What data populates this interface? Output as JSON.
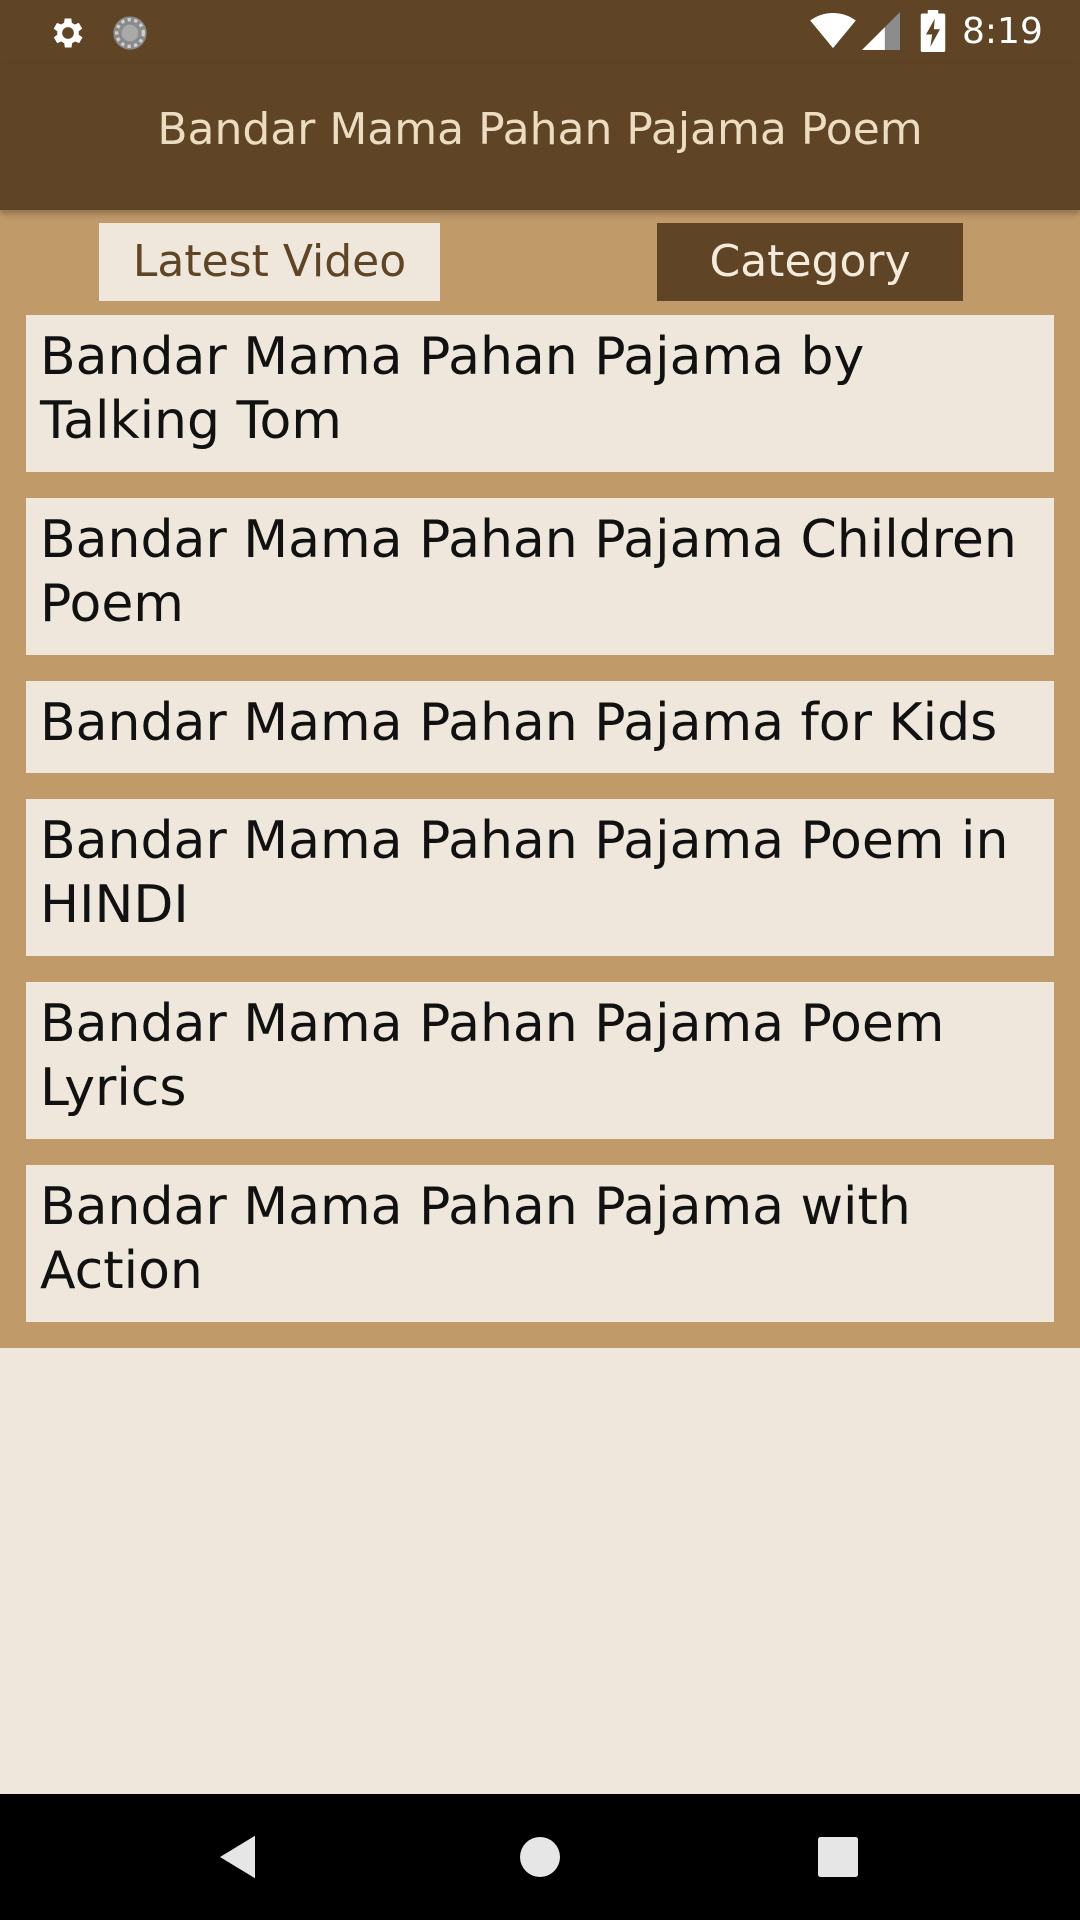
{
  "status_bar": {
    "time": "8:19",
    "left_icons": [
      "gear-icon",
      "sync-icon"
    ],
    "right_icons": [
      "wifi-icon",
      "signal-icon",
      "battery-charging-icon"
    ]
  },
  "app_bar": {
    "title": "Bandar Mama Pahan Pajama Poem"
  },
  "tabs": [
    {
      "label": "Latest Video",
      "selected": false
    },
    {
      "label": "Category",
      "selected": true
    }
  ],
  "videos": [
    {
      "title": "Bandar Mama Pahan Pajama by Talking Tom"
    },
    {
      "title": "Bandar Mama Pahan Pajama Children Poem"
    },
    {
      "title": "Bandar Mama Pahan Pajama for Kids"
    },
    {
      "title": "Bandar Mama Pahan Pajama Poem in HINDI"
    },
    {
      "title": "Bandar Mama Pahan Pajama Poem Lyrics"
    },
    {
      "title": "Bandar Mama Pahan Pajama with Action"
    }
  ],
  "nav_bar": {
    "buttons": [
      "back-icon",
      "home-icon",
      "recents-icon"
    ]
  },
  "colors": {
    "header": "#5f4425",
    "header_text": "#ecdcc2",
    "panel": "#c19a6a",
    "item_background": "#efe7dc",
    "page_background": "#efe7dc",
    "nav_bar": "#000000"
  }
}
